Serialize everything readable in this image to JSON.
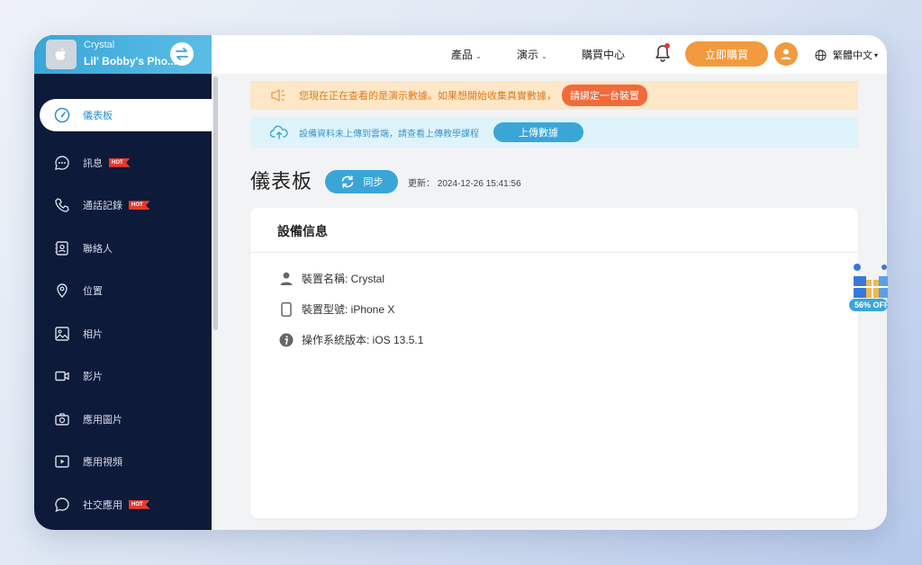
{
  "device": {
    "name": "Crystal",
    "model": "Lil' Bobby's Pho..."
  },
  "sidebar": {
    "items": [
      {
        "label": "儀表板",
        "icon": "gauge-icon",
        "active": true
      },
      {
        "label": "訊息",
        "icon": "chat-icon",
        "hot": "HOT"
      },
      {
        "label": "通話記錄",
        "icon": "phone-icon",
        "hot": "HOT"
      },
      {
        "label": "聯絡人",
        "icon": "contacts-icon"
      },
      {
        "label": "位置",
        "icon": "location-pin-icon"
      },
      {
        "label": "相片",
        "icon": "image-icon"
      },
      {
        "label": "影片",
        "icon": "video-icon"
      },
      {
        "label": "應用圖片",
        "icon": "camera-icon"
      },
      {
        "label": "應用視頻",
        "icon": "play-icon"
      },
      {
        "label": "社交應用",
        "icon": "speech-bubble-icon",
        "hot": "HOT"
      }
    ]
  },
  "topbar": {
    "products": "產品",
    "demo": "演示",
    "store": "購買中心",
    "buy_now": "立即購買",
    "language": "繁體中文"
  },
  "banner": {
    "demo_text": "您現在正在查看的是演示數據。如果想開始收集真實數據，",
    "demo_action": "請綁定一台裝置",
    "cloud_text": "設備資料未上傳到雲端，請查看上傳教學課程",
    "upload_label": "上傳數據"
  },
  "main": {
    "title": "儀表板",
    "sync_label": "同步",
    "updated": "更新： 2024-12-26 15:41:56"
  },
  "card": {
    "title": "設備信息",
    "rows": [
      {
        "text": "裝置名稱: Crystal",
        "icon": "user-icon"
      },
      {
        "text": "裝置型號: iPhone X",
        "icon": "phone-device-icon"
      },
      {
        "text": "操作系統版本: iOS 13.5.1",
        "icon": "info-icon"
      }
    ]
  },
  "promo": {
    "label": "56% OFF"
  },
  "colors": {
    "accent": "#3aa6d8",
    "orange": "#f19a3e",
    "sidebar": "#0d1a3a"
  }
}
